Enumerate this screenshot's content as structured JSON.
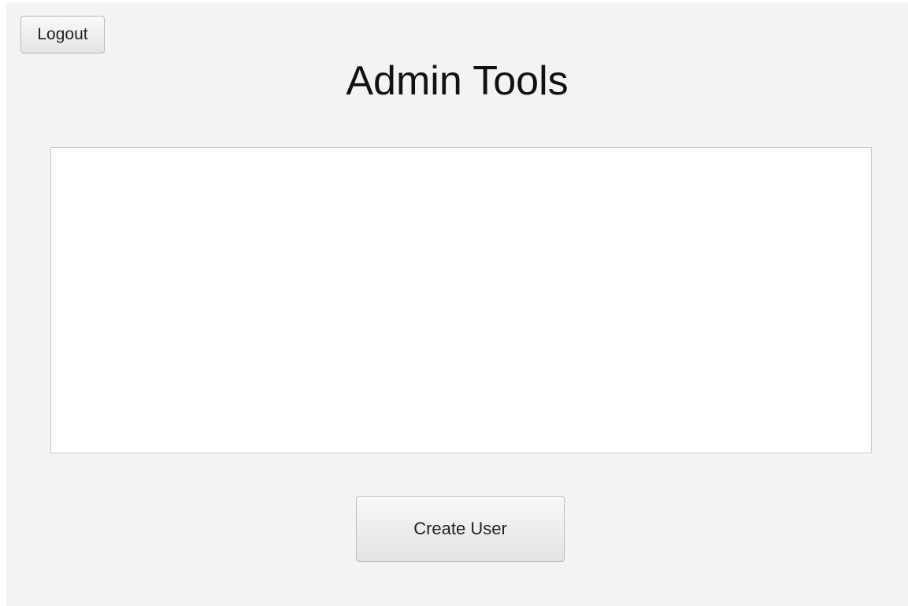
{
  "header": {
    "logout_label": "Logout",
    "title": "Admin Tools"
  },
  "main": {
    "user_list_items": []
  },
  "footer": {
    "create_user_label": "Create User"
  }
}
